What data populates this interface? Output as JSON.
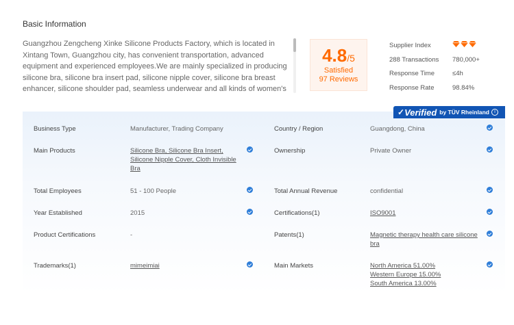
{
  "section_title": "Basic Information",
  "description": "Guangzhou Zengcheng Xinke Silicone Products Factory, which is located in Xintang Town, Guangzhou city, has convenient transportation, advanced equipment and experienced employees.We are mainly specialized in producing silicone bra, silicone bra insert pad, silicone nipple cover, silicone bra breast enhancer, silicone shoulder pad, seamless underwear and all kinds of women's fashion products and other",
  "rating": {
    "score": "4.8",
    "out_of": "/5",
    "satisfied": "Satisfied",
    "reviews": "97 Reviews"
  },
  "supplier_stats": {
    "index_label": "Supplier Index",
    "transactions": {
      "label": "288 Transactions",
      "value": "780,000+"
    },
    "response_time": {
      "label": "Response Time",
      "value": "≤4h"
    },
    "response_rate": {
      "label": "Response Rate",
      "value": "98.84%"
    }
  },
  "verified": {
    "check": "✓",
    "label": "Verified",
    "by": "by TÜV Rheinland",
    "info": "i"
  },
  "colors": {
    "accent": "#ff6a00",
    "verified_blue": "#1155b4",
    "badge_blue": "#2f7ed8"
  },
  "rows": {
    "business_type": {
      "label": "Business Type",
      "value": "Manufacturer, Trading Company"
    },
    "country_region": {
      "label": "Country / Region",
      "value": "Guangdong, China"
    },
    "main_products": {
      "label": "Main Products",
      "values": [
        "Silicone Bra, Silicone Bra Insert,",
        "Silicone Nipple Cover, Cloth Invisible",
        "Bra"
      ]
    },
    "ownership": {
      "label": "Ownership",
      "value": "Private Owner"
    },
    "total_employees": {
      "label": "Total Employees",
      "value": "51 - 100 People"
    },
    "total_annual_revenue": {
      "label": "Total Annual Revenue",
      "value": "confidential"
    },
    "year_established": {
      "label": "Year Established",
      "value": "2015"
    },
    "certifications": {
      "label": "Certifications(1)",
      "value": "ISO9001"
    },
    "product_certifications": {
      "label": "Product Certifications",
      "value": "-"
    },
    "patents": {
      "label": "Patents(1)",
      "values": [
        "Magnetic therapy health care silicone",
        "bra"
      ]
    },
    "trademarks": {
      "label": "Trademarks(1)",
      "value": "mimeimiai"
    },
    "main_markets": {
      "label": "Main Markets",
      "values": [
        "North America 51.00%",
        "Western Europe 15.00%",
        "South America 13.00%"
      ]
    }
  }
}
